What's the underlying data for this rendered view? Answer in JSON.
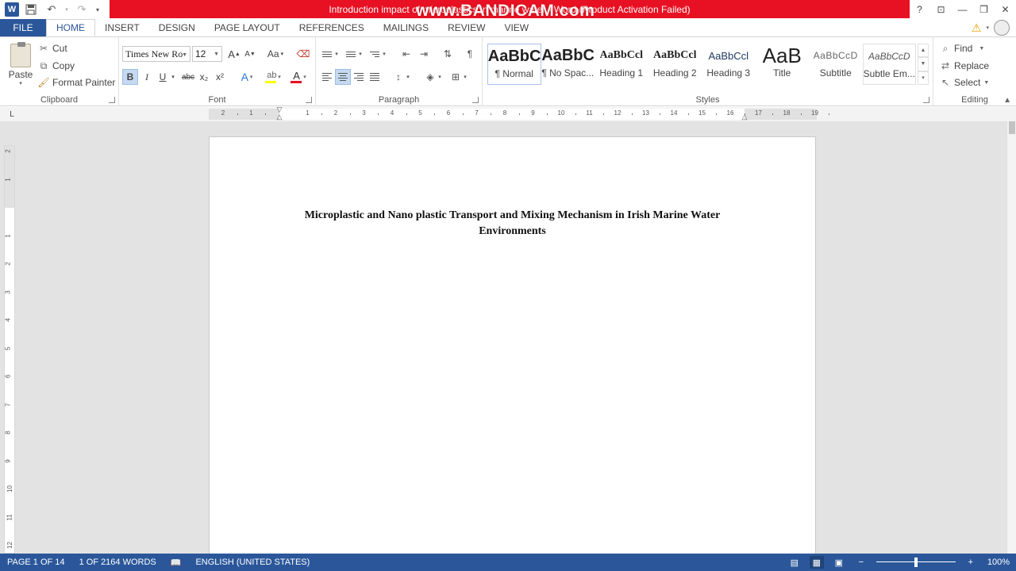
{
  "titlebar": {
    "title": "Introduction impact of microplastics in marine water - Word (Product Activation Failed)",
    "watermark": "www.BANDICAM.com",
    "icons": [
      "word-logo-icon",
      "save-icon",
      "undo-icon",
      "redo-icon",
      "customize-qat-icon"
    ]
  },
  "window": {
    "help": "?",
    "display_options": "⊡",
    "minimize": "—",
    "restore": "❐",
    "close": "✕"
  },
  "tabs": [
    {
      "label": "FILE"
    },
    {
      "label": "HOME"
    },
    {
      "label": "INSERT"
    },
    {
      "label": "DESIGN"
    },
    {
      "label": "PAGE LAYOUT"
    },
    {
      "label": "REFERENCES"
    },
    {
      "label": "MAILINGS"
    },
    {
      "label": "REVIEW"
    },
    {
      "label": "VIEW"
    }
  ],
  "clipboard": {
    "group_label": "Clipboard",
    "paste": "Paste",
    "cut": "Cut",
    "copy": "Copy",
    "format_painter": "Format Painter"
  },
  "font": {
    "group_label": "Font",
    "name": "Times New Ro",
    "size": "12",
    "bold": "B",
    "italic": "I",
    "underline": "U",
    "strikethrough": "abc",
    "subscript": "x₂",
    "superscript": "x²",
    "grow": "A",
    "shrink": "A",
    "case": "Aa",
    "font_color_letter": "A",
    "text_effects": "A",
    "highlight_color": "#ffff00",
    "font_color": "#e81123"
  },
  "paragraph": {
    "group_label": "Paragraph",
    "show_marks": "¶"
  },
  "styles": {
    "group_label": "Styles",
    "items": [
      {
        "preview": "AaBbC",
        "name": "¶ Normal",
        "selected": true
      },
      {
        "preview": "AaBbC",
        "name": "¶ No Spac..."
      },
      {
        "preview": "AaBbCcl",
        "name": "Heading 1"
      },
      {
        "preview": "AaBbCcl",
        "name": "Heading 2"
      },
      {
        "preview": "AaBbCcl",
        "name": "Heading 3"
      },
      {
        "preview": "AaB",
        "name": "Title"
      },
      {
        "preview": "AaBbCcD",
        "name": "Subtitle"
      },
      {
        "preview": "AaBbCcD",
        "name": "Subtle Em..."
      }
    ]
  },
  "editing": {
    "group_label": "Editing",
    "find": "Find",
    "replace": "Replace",
    "select": "Select"
  },
  "ruler": {
    "horizontal_labels": [
      "2",
      "1",
      "1",
      "2",
      "3",
      "4",
      "5",
      "6",
      "7",
      "8",
      "9",
      "10",
      "11",
      "12",
      "13",
      "14",
      "15",
      "16",
      "17",
      "18",
      "19"
    ],
    "vertical_labels": [
      "2",
      "1",
      "1",
      "2",
      "3",
      "4",
      "5",
      "6",
      "7",
      "8",
      "9",
      "10",
      "11",
      "12"
    ],
    "tab_selector": "L"
  },
  "document": {
    "title_line1": "Microplastic and Nano plastic Transport and Mixing Mechanism in Irish Marine Water",
    "title_line2": "Environments"
  },
  "statusbar": {
    "page": "PAGE 1 OF 14",
    "words": "1 OF 2164 WORDS",
    "language": "ENGLISH (UNITED STATES)",
    "zoom": "100%",
    "zoom_minus": "−",
    "zoom_plus": "+",
    "zoom_level": 0.5
  }
}
